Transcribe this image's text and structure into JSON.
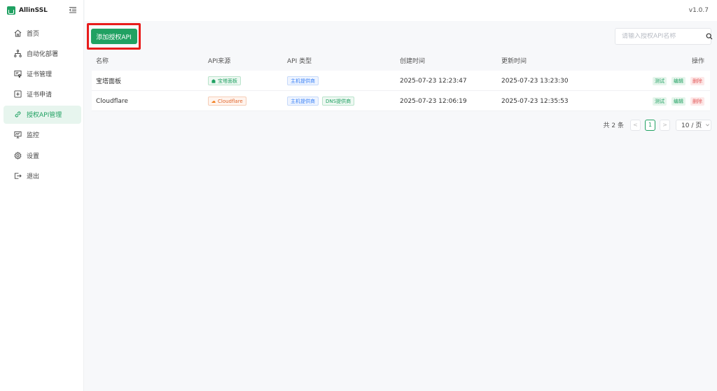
{
  "app": {
    "name": "AllinSSL",
    "version": "v1.0.7"
  },
  "sidebar": {
    "items": [
      {
        "label": "首页",
        "icon": "home-icon",
        "active": false
      },
      {
        "label": "自动化部署",
        "icon": "workflow-icon",
        "active": false
      },
      {
        "label": "证书管理",
        "icon": "certificate-icon",
        "active": false
      },
      {
        "label": "证书申请",
        "icon": "add-box-icon",
        "active": false
      },
      {
        "label": "授权API管理",
        "icon": "link-icon",
        "active": true
      },
      {
        "label": "监控",
        "icon": "monitor-icon",
        "active": false
      },
      {
        "label": "设置",
        "icon": "gear-icon",
        "active": false
      },
      {
        "label": "退出",
        "icon": "logout-icon",
        "active": false
      }
    ]
  },
  "toolbar": {
    "add_label": "添加授权API",
    "search_placeholder": "请输入授权API名称"
  },
  "table": {
    "columns": [
      "名称",
      "API来源",
      "API 类型",
      "创建时间",
      "更新时间",
      "操作"
    ],
    "rows": [
      {
        "name": "宝塔面板",
        "source": "宝塔面板",
        "types": [
          "主机提供商"
        ],
        "created": "2025-07-23 12:23:47",
        "updated": "2025-07-23 13:23:30"
      },
      {
        "name": "Cloudflare",
        "source": "Cloudflare",
        "types": [
          "主机提供商",
          "DNS提供商"
        ],
        "created": "2025-07-23 12:06:19",
        "updated": "2025-07-23 12:35:53"
      }
    ],
    "actions": {
      "test": "测试",
      "edit": "编辑",
      "delete": "删除"
    }
  },
  "pagination": {
    "total": "共 2 条",
    "prev": "<",
    "current": "1",
    "next": ">",
    "page_size": "10 / 页"
  },
  "colors": {
    "brand": "#20a162",
    "danger": "#e35a5a",
    "highlight": "#e81c1c"
  }
}
